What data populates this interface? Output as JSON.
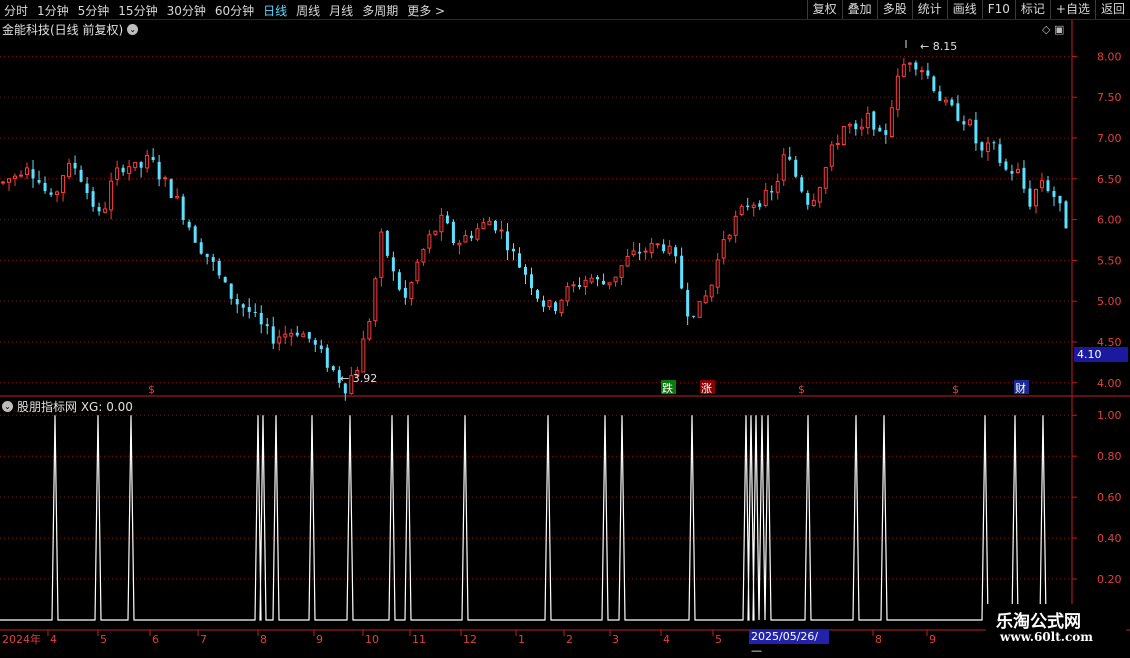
{
  "toolbar": {
    "periods": [
      "分时",
      "1分钟",
      "5分钟",
      "15分钟",
      "30分钟",
      "60分钟",
      "日线",
      "周线",
      "月线",
      "多周期",
      "更多 >"
    ],
    "active_period": "日线",
    "right_buttons": [
      "复权",
      "叠加",
      "多股",
      "统计",
      "画线",
      "F10",
      "标记",
      "+自选",
      "返回"
    ]
  },
  "chart_title": "金能科技(日线 前复权)",
  "indicator_title": "股朋指标网 XG: 0.00",
  "price_axis": [
    "8.00",
    "7.50",
    "7.00",
    "6.50",
    "6.00",
    "5.50",
    "5.00",
    "4.50",
    "4.00"
  ],
  "indicator_axis": [
    "1.00",
    "0.80",
    "0.60",
    "0.40",
    "0.20"
  ],
  "current_price_label": "4.10",
  "high_label": "8.15",
  "low_label": "3.92",
  "markers": {
    "down": "跌",
    "up": "涨",
    "dollar": "$",
    "finance": "财"
  },
  "x_axis": {
    "year": "2024年",
    "months": [
      "4",
      "5",
      "6",
      "7",
      "8",
      "9",
      "10",
      "11",
      "12",
      "1",
      "2",
      "3",
      "4",
      "5",
      "8",
      "9"
    ]
  },
  "cursor_date": "2025/05/26/—",
  "watermark": {
    "line1": "乐淘公式网",
    "line2": "www.60lt.com"
  },
  "colors": {
    "up": "#ff3b3b",
    "down": "#5ee0ff",
    "grid": "#8a1010",
    "axis": "#c02020",
    "signal": "#ffffff",
    "axis_text": "#e04040"
  },
  "chart_data": {
    "type": "candlestick",
    "ylim": [
      3.85,
      8.25
    ],
    "close_trend": [
      6.45,
      6.55,
      6.7,
      6.45,
      6.2,
      6.6,
      6.65,
      6.3,
      6.0,
      6.5,
      6.7,
      6.6,
      6.75,
      6.5,
      6.3,
      6.0,
      5.7,
      5.5,
      5.2,
      5.0,
      4.9,
      4.7,
      4.55,
      4.6,
      4.65,
      4.55,
      4.35,
      4.15,
      3.95,
      4.2,
      4.8,
      5.8,
      5.3,
      5.0,
      5.5,
      5.8,
      6.0,
      5.7,
      5.8,
      5.9,
      6.0,
      5.8,
      5.5,
      5.3,
      5.0,
      4.9,
      5.1,
      5.2,
      5.3,
      5.2,
      5.3,
      5.5,
      5.6,
      5.65,
      5.7,
      5.5,
      4.9,
      4.9,
      5.2,
      5.8,
      6.0,
      6.2,
      6.25,
      6.3,
      6.8,
      6.5,
      6.2,
      6.5,
      6.9,
      7.2,
      7.0,
      7.3,
      6.9,
      7.6,
      8.0,
      7.9,
      7.7,
      7.4,
      7.3,
      7.2,
      6.8,
      6.9,
      6.6,
      6.6,
      6.2,
      6.5,
      6.3,
      5.95
    ],
    "signals": [
      55,
      98,
      131,
      258,
      263,
      276,
      312,
      350,
      392,
      408,
      465,
      548,
      605,
      622,
      692,
      746,
      751,
      756,
      762,
      768,
      808,
      856,
      884,
      985,
      1015,
      1043
    ],
    "indicator_ylim": [
      0,
      1.05
    ],
    "price_ticks": [
      8.0,
      7.5,
      7.0,
      6.5,
      6.0,
      5.5,
      5.0,
      4.5,
      4.0
    ],
    "indicator_ticks": [
      1.0,
      0.8,
      0.6,
      0.4,
      0.2
    ]
  }
}
